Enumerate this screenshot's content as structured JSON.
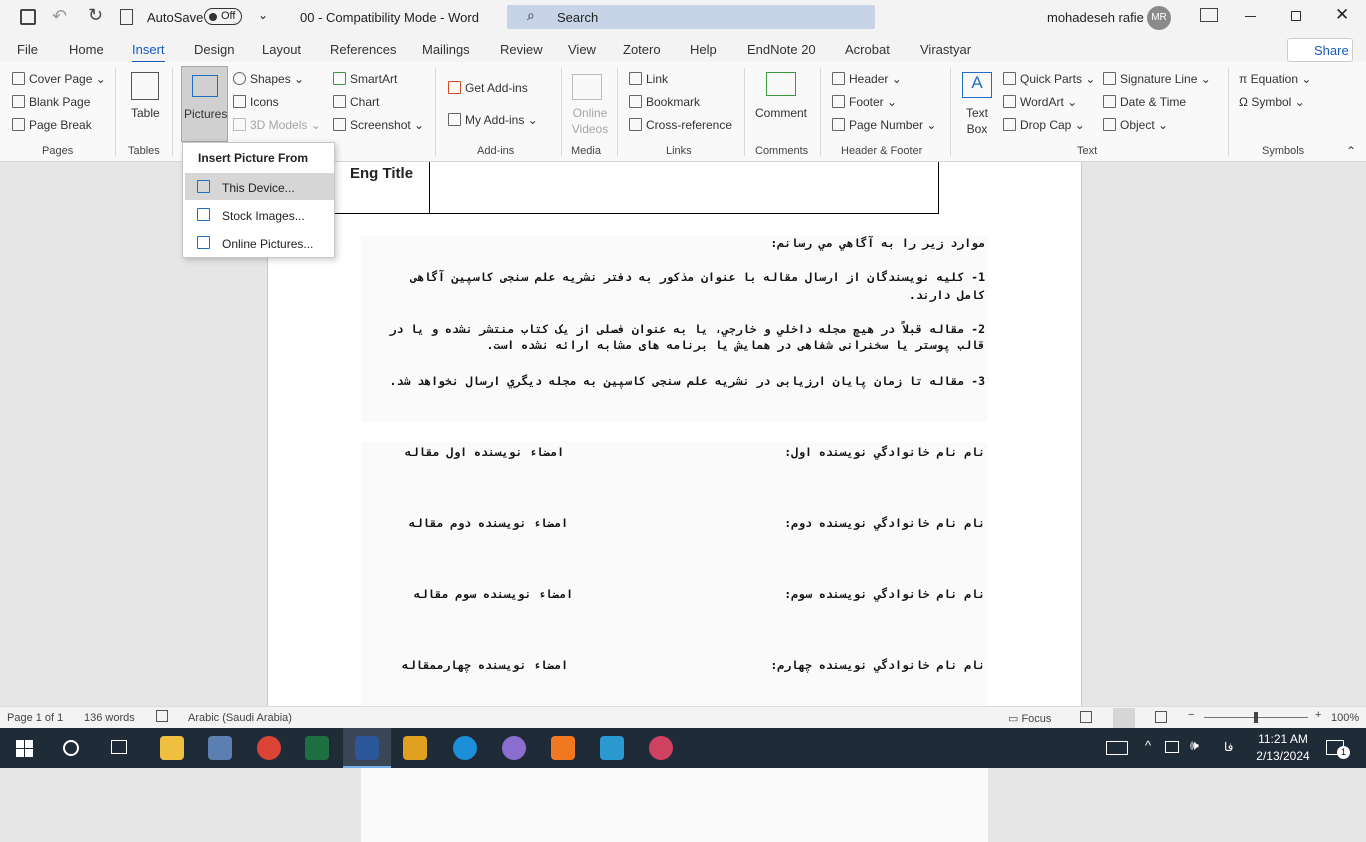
{
  "titlebar": {
    "autosave_label": "AutoSave",
    "autosave_state": "Off",
    "doc_title": "00  -  Compatibility Mode  -  Word",
    "search_placeholder": "Search",
    "user_name": "mohadeseh rafie",
    "user_initials": "MR"
  },
  "tabs": [
    "File",
    "Home",
    "Insert",
    "Design",
    "Layout",
    "References",
    "Mailings",
    "Review",
    "View",
    "Zotero",
    "Help",
    "EndNote 20",
    "Acrobat",
    "Virastyar"
  ],
  "active_tab": "Insert",
  "share_label": "Share",
  "ribbon": {
    "pages": {
      "items": [
        "Cover Page",
        "Blank Page",
        "Page Break"
      ],
      "label": "Pages"
    },
    "tables": {
      "items": [
        "Table"
      ],
      "label": "Tables"
    },
    "illustrations": {
      "pictures": "Pictures",
      "items": [
        "Shapes",
        "Icons",
        "3D Models",
        "SmartArt",
        "Chart",
        "Screenshot"
      ]
    },
    "addins": {
      "items": [
        "Get Add-ins",
        "My Add-ins"
      ],
      "label": "Add-ins"
    },
    "media": {
      "items": [
        "Online Videos"
      ],
      "label": "Media"
    },
    "links": {
      "items": [
        "Link",
        "Bookmark",
        "Cross-reference"
      ],
      "label": "Links"
    },
    "comments": {
      "items": [
        "Comment"
      ],
      "label": "Comments"
    },
    "header_footer": {
      "items": [
        "Header",
        "Footer",
        "Page Number"
      ],
      "label": "Header & Footer"
    },
    "text": {
      "items": [
        "Text Box",
        "Quick Parts",
        "WordArt",
        "Drop Cap",
        "Signature Line",
        "Date & Time",
        "Object"
      ],
      "label": "Text"
    },
    "symbols": {
      "items": [
        "Equation",
        "Symbol"
      ],
      "label": "Symbols"
    }
  },
  "picture_menu": {
    "title": "Insert Picture From",
    "items": [
      "This Device...",
      "Stock Images...",
      "Online Pictures..."
    ],
    "highlighted": "This Device..."
  },
  "document": {
    "table_label": "Eng Title",
    "intro": "موارد زير را به آگاهي مي رسانم:",
    "item1_line1": "1- کلیه نویسندگان از ارسال مقاله با عنوان مذکور به دفتر نشریه علم سنجی کاسپین آگاهی",
    "item1_line2": "کامل دارند.",
    "item2_line1": "2- مقاله قبلاً در هيچ مجله داخلي و خارجي، یا به عنوان فصلی از یک کتاب منتشر نشده و یا در",
    "item2_line2": "قالب پوستر یا سخنرانی شفاهی در همایش یا برنامه های مشابه ارائه نشده است.",
    "item3": "3- مقاله تا زمان پایان ارزیابی در نشریه علم سنجی کاسپین به مجله ديگري ارسال نخواهد شد.",
    "authors": [
      {
        "name": "نام نام خانوادگي نويسنده اول:",
        "sign": "امضاء نویسنده اول مقاله"
      },
      {
        "name": "نام نام خانوادگي نويسنده دوم:",
        "sign": "امضاء نویسنده دوم مقاله"
      },
      {
        "name": "نام نام خانوادگي نويسنده سوم:",
        "sign": "امضاء نویسنده سوم مقاله"
      },
      {
        "name": "نام نام خانوادگي نويسنده چهارم:",
        "sign": "امضاء نویسنده چهارممقاله"
      }
    ]
  },
  "status": {
    "page": "Page 1 of 1",
    "words": "136 words",
    "language": "Arabic (Saudi Arabia)",
    "focus": "Focus",
    "zoom": "100%"
  },
  "taskbar": {
    "lang": "فا",
    "time": "11:21 AM",
    "date": "2/13/2024",
    "notifications": "1"
  },
  "colors": {
    "accent": "#185abd",
    "taskbar": "#202b38"
  }
}
